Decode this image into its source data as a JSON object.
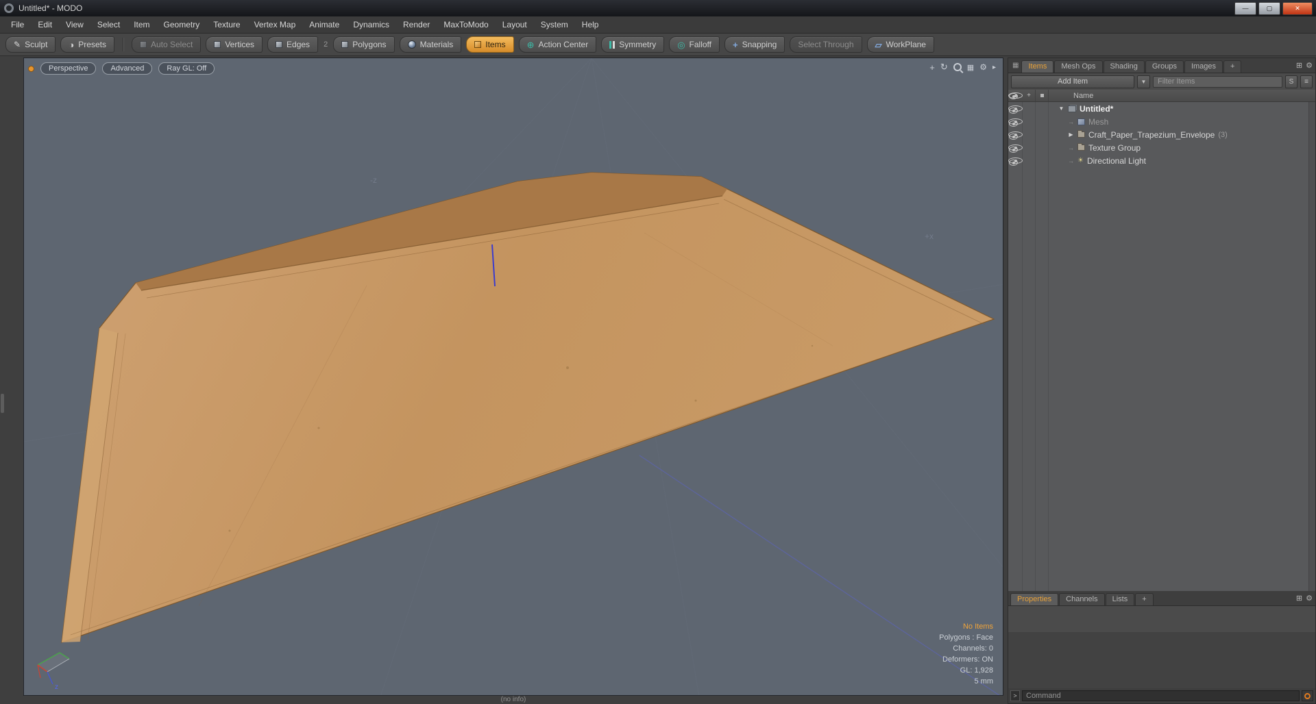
{
  "window": {
    "title": "Untitled* - MODO",
    "controls": {
      "minimize": "—",
      "maximize": "▢",
      "close": "✕"
    }
  },
  "menu_bar": {
    "items": [
      "File",
      "Edit",
      "View",
      "Select",
      "Item",
      "Geometry",
      "Texture",
      "Vertex Map",
      "Animate",
      "Dynamics",
      "Render",
      "MaxToModo",
      "Layout",
      "System",
      "Help"
    ]
  },
  "toolbar": {
    "buttons": [
      {
        "label": "Sculpt"
      },
      {
        "label": "Presets"
      },
      {
        "label": "Auto Select"
      },
      {
        "label": "Vertices"
      },
      {
        "label": "Edges"
      },
      {
        "label": "Polygons"
      },
      {
        "label": "Materials"
      },
      {
        "label": "Items"
      },
      {
        "label": "Action Center"
      },
      {
        "label": "Symmetry"
      },
      {
        "label": "Falloff"
      },
      {
        "label": "Snapping"
      },
      {
        "label": "Select Through"
      },
      {
        "label": "WorkPlane"
      }
    ],
    "edges_shortcut_hint": "2"
  },
  "viewport": {
    "mode_buttons": [
      "Perspective",
      "Advanced",
      "Ray GL: Off"
    ],
    "axis_labels": {
      "neg_z": "-z",
      "pos_x": "+x",
      "gizmo_z": "z"
    },
    "stats": {
      "highlight": "No Items",
      "lines": [
        "Polygons : Face",
        "Channels: 0",
        "Deformers: ON",
        "GL: 1,928",
        "5 mm"
      ]
    },
    "status_bar": "(no info)"
  },
  "item_list_panel": {
    "tabs": [
      "Items",
      "Mesh Ops",
      "Shading",
      "Groups",
      "Images",
      "+"
    ],
    "add_item_button": "Add Item",
    "filter_placeholder": "Filter Items",
    "s_button": "S",
    "name_column": "Name",
    "tree": [
      {
        "label": "Untitled*",
        "suffix": ""
      },
      {
        "label": "Mesh",
        "suffix": ""
      },
      {
        "label": "Craft_Paper_Trapezium_Envelope",
        "suffix": "(3)"
      },
      {
        "label": "Texture Group",
        "suffix": ""
      },
      {
        "label": "Directional Light",
        "suffix": ""
      }
    ]
  },
  "bottom_panel": {
    "tabs": [
      "Properties",
      "Channels",
      "Lists",
      "+"
    ],
    "command_prompt": ">",
    "command_placeholder": "Command"
  }
}
